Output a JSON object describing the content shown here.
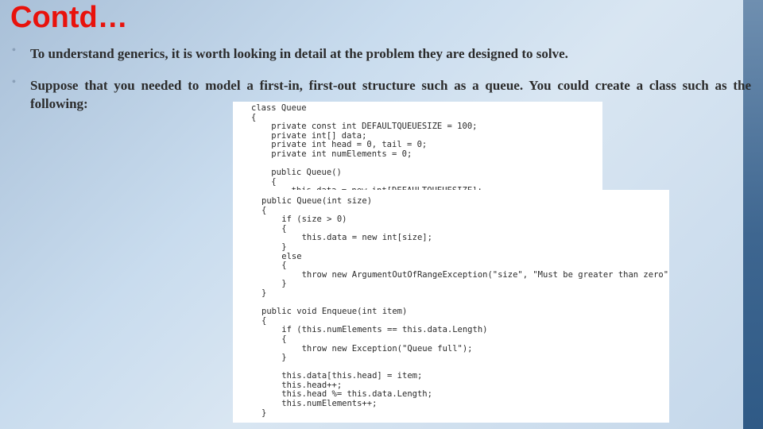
{
  "title": "Contd…",
  "bullets": [
    "To understand generics, it is worth looking in detail at the problem they are designed to solve.",
    "Suppose that you needed to model a first-in, first-out structure such as a queue. You could create a class such as the following:"
  ],
  "code_top": "class Queue\n{\n    private const int DEFAULTQUEUESIZE = 100;\n    private int[] data;\n    private int head = 0, tail = 0;\n    private int numElements = 0;\n\n    public Queue()\n    {\n        this.data = new int[DEFAULTQUEUESIZE];\n    }",
  "code_bottom": "public Queue(int size)\n{\n    if (size > 0)\n    {\n        this.data = new int[size];\n    }\n    else\n    {\n        throw new ArgumentOutOfRangeException(\"size\", \"Must be greater than zero\");\n    }\n}\n\npublic void Enqueue(int item)\n{\n    if (this.numElements == this.data.Length)\n    {\n        throw new Exception(\"Queue full\");\n    }\n\n    this.data[this.head] = item;\n    this.head++;\n    this.head %= this.data.Length;\n    this.numElements++;\n}"
}
